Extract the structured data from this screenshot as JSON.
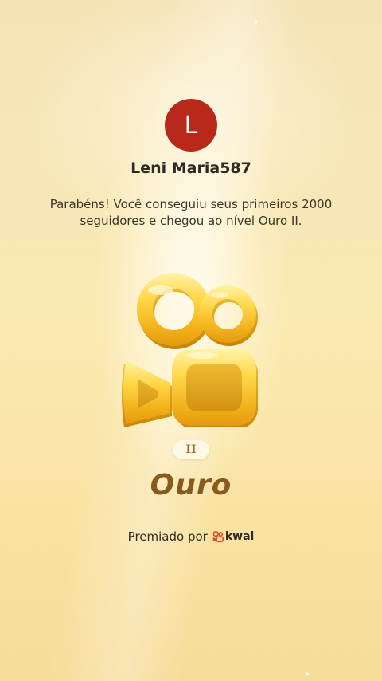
{
  "user": {
    "avatar_initial": "L",
    "name": "Leni Maria587"
  },
  "message": "Parabéns! Você conseguiu seus primeiros 2000 seguidores e chegou ao nível Ouro II.",
  "badge": {
    "icon": "kwai-logo-badge-icon",
    "level_numeral": "II",
    "level_name": "Ouro"
  },
  "footer": {
    "awarded_by_label": "Premiado por",
    "brand_name": "kwai",
    "brand_icon": "kwai-logo-icon"
  },
  "colors": {
    "avatar_bg": "#b8291c",
    "gold": "#f2c12e",
    "level_text": "#8a5a1c",
    "brand_red": "#e8412c"
  }
}
